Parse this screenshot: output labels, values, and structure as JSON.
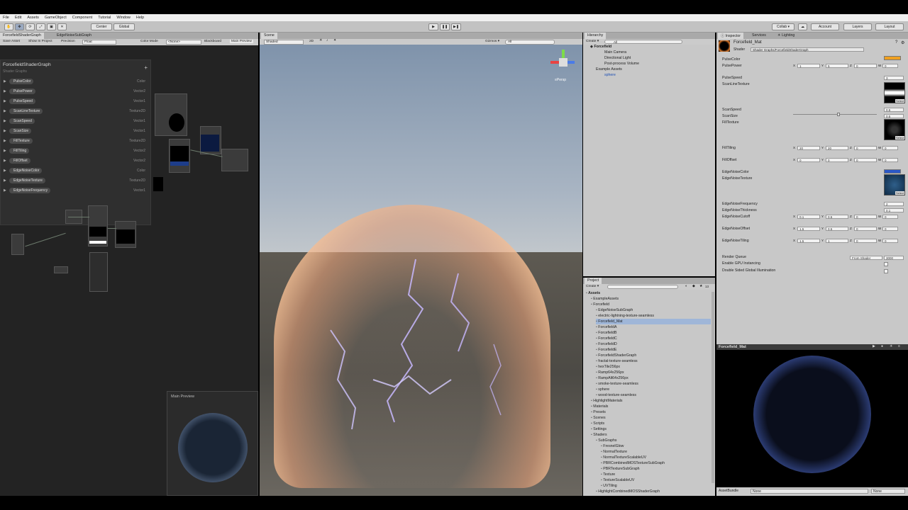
{
  "menu": [
    "File",
    "Edit",
    "Assets",
    "GameObject",
    "Component",
    "Tutorial",
    "Window",
    "Help"
  ],
  "toolbar": {
    "center": "Center",
    "global": "Global",
    "collab": "Collab ▾",
    "account": "Account",
    "layers": "Layers",
    "layout": "Layout"
  },
  "shader_graph": {
    "tabs": [
      "ForcefieldShaderGraph",
      "EdgeNoiseSubGraph"
    ],
    "toolbar": {
      "save": "Save Asset",
      "show": "Show In Project",
      "precision_label": "Precision",
      "precision_value": "Float",
      "color_mode_label": "Color Mode",
      "color_mode_value": "<None>",
      "blackboard": "Blackboard",
      "main_preview": "Main Preview"
    },
    "blackboard_title": "ForcefieldShaderGraph",
    "blackboard_subtitle": "Shader Graphs",
    "properties": [
      {
        "name": "PulseColor",
        "type": "Color"
      },
      {
        "name": "PulsePower",
        "type": "Vector2"
      },
      {
        "name": "PulseSpeed",
        "type": "Vector1"
      },
      {
        "name": "ScanLineTexture",
        "type": "Texture2D"
      },
      {
        "name": "ScanSpeed",
        "type": "Vector1"
      },
      {
        "name": "ScanSize",
        "type": "Vector1"
      },
      {
        "name": "FillTexture",
        "type": "Texture2D"
      },
      {
        "name": "FillTiling",
        "type": "Vector2"
      },
      {
        "name": "FillOffset",
        "type": "Vector2"
      },
      {
        "name": "EdgeNoiseColor",
        "type": "Color"
      },
      {
        "name": "EdgeNoiseTexture",
        "type": "Texture2D"
      },
      {
        "name": "EdgeNoiseFrequency",
        "type": "Vector1"
      }
    ],
    "main_preview_title": "Main Preview"
  },
  "scene": {
    "tab": "Scene",
    "shading": "Shaded",
    "mode": "2D",
    "gizmos": "Gizmos ▾",
    "search": "All",
    "persp": "≡Persp"
  },
  "hierarchy": {
    "tab": "Hierarchy",
    "create": "Create ▾",
    "search": "All",
    "root": "Forcefield",
    "items": [
      "Main Camera",
      "Directional Light",
      "Post-process Volume",
      "Example Assets",
      "sphere"
    ]
  },
  "project": {
    "tab": "Project",
    "create": "Create ▾",
    "count": "13",
    "items": [
      {
        "label": "Assets",
        "indent": 0,
        "bold": true
      },
      {
        "label": "ExampleAssets",
        "indent": 1
      },
      {
        "label": "Forcefield",
        "indent": 1
      },
      {
        "label": "EdgeNoiseSubGraph",
        "indent": 2
      },
      {
        "label": "electric-lightning-texture-seamless",
        "indent": 2
      },
      {
        "label": "Forcefield_Mat",
        "indent": 2,
        "selected": true
      },
      {
        "label": "ForcefieldA",
        "indent": 2
      },
      {
        "label": "ForcefieldB",
        "indent": 2
      },
      {
        "label": "ForcefieldC",
        "indent": 2
      },
      {
        "label": "ForcefieldD",
        "indent": 2
      },
      {
        "label": "ForcefieldE",
        "indent": 2
      },
      {
        "label": "ForcefieldShaderGraph",
        "indent": 2
      },
      {
        "label": "fractal-texture-seamless",
        "indent": 2
      },
      {
        "label": "hexTile256px",
        "indent": 2
      },
      {
        "label": "Ramp64x256px",
        "indent": 2
      },
      {
        "label": "RampAlt64x256px",
        "indent": 2
      },
      {
        "label": "smoke-texture-seamless",
        "indent": 2
      },
      {
        "label": "sphere",
        "indent": 2
      },
      {
        "label": "wood-texture-seamless",
        "indent": 2
      },
      {
        "label": "HighlightMaterials",
        "indent": 1
      },
      {
        "label": "Materials",
        "indent": 1
      },
      {
        "label": "Presets",
        "indent": 1
      },
      {
        "label": "Scenes",
        "indent": 1
      },
      {
        "label": "Scripts",
        "indent": 1
      },
      {
        "label": "Settings",
        "indent": 1
      },
      {
        "label": "Shaders",
        "indent": 1
      },
      {
        "label": "SubGraphs",
        "indent": 2
      },
      {
        "label": "FresnelGlow",
        "indent": 3
      },
      {
        "label": "NormalTexture",
        "indent": 3
      },
      {
        "label": "NormalTextureScalableUV",
        "indent": 3
      },
      {
        "label": "PBRCombinedMOSTextureSubGraph",
        "indent": 3
      },
      {
        "label": "PBRTextureSubGraph",
        "indent": 3
      },
      {
        "label": "Texture",
        "indent": 3
      },
      {
        "label": "TextureScalableUV",
        "indent": 3
      },
      {
        "label": "UVTiling",
        "indent": 3
      },
      {
        "label": "HighlightCombinedMOSShaderGraph",
        "indent": 2
      }
    ]
  },
  "inspector": {
    "tabs": [
      "Inspector",
      "Services",
      "Lighting"
    ],
    "material": "Forcefield_Mat",
    "shader_label": "Shader",
    "shader_value": "Shader Graphs/ForcefieldShaderGraph",
    "rows": [
      {
        "label": "PulseColor"
      },
      {
        "label": "PulsePower",
        "x": "1",
        "y": "5",
        "z": "0",
        "w": "0"
      },
      {
        "label": "PulseSpeed",
        "v": "3"
      },
      {
        "label": "ScanLineTexture"
      },
      {
        "label": "ScanSpeed",
        "v": "0.5"
      },
      {
        "label": "ScanSize",
        "v": "0.5"
      },
      {
        "label": "FillTexture"
      },
      {
        "label": "FillTiling",
        "x": "20",
        "y": "20",
        "z": "0",
        "w": "0"
      },
      {
        "label": "FillOffset",
        "x": "0",
        "y": "0",
        "z": "0",
        "w": "0"
      },
      {
        "label": "EdgeNoiseColor"
      },
      {
        "label": "EdgeNoiseTexture"
      },
      {
        "label": "EdgeNoiseFrequency",
        "v": "2"
      },
      {
        "label": "EdgeNoiseThickness",
        "v": "0.1"
      },
      {
        "label": "EdgeNoiseCutoff",
        "x": "0.1",
        "y": "0.5",
        "z": "0",
        "w": "0"
      },
      {
        "label": "EdgeNoiseOffset",
        "x": "1.5",
        "y": "0.5",
        "z": "0",
        "w": "0"
      },
      {
        "label": "EdgeNoiseTiling",
        "x": "1.5",
        "y": "1",
        "z": "0",
        "w": "0"
      }
    ],
    "render_queue_label": "Render Queue",
    "render_queue_mode": "From Shader",
    "render_queue_value": "3000",
    "gpu_instancing": "Enable GPU Instancing",
    "double_sided": "Double Sided Global Illumination",
    "select": "Select",
    "preview_title": "Forcefield_Mat",
    "asset_bundle_label": "AssetBundle",
    "asset_bundle_value": "None",
    "asset_bundle_variant": "None"
  }
}
